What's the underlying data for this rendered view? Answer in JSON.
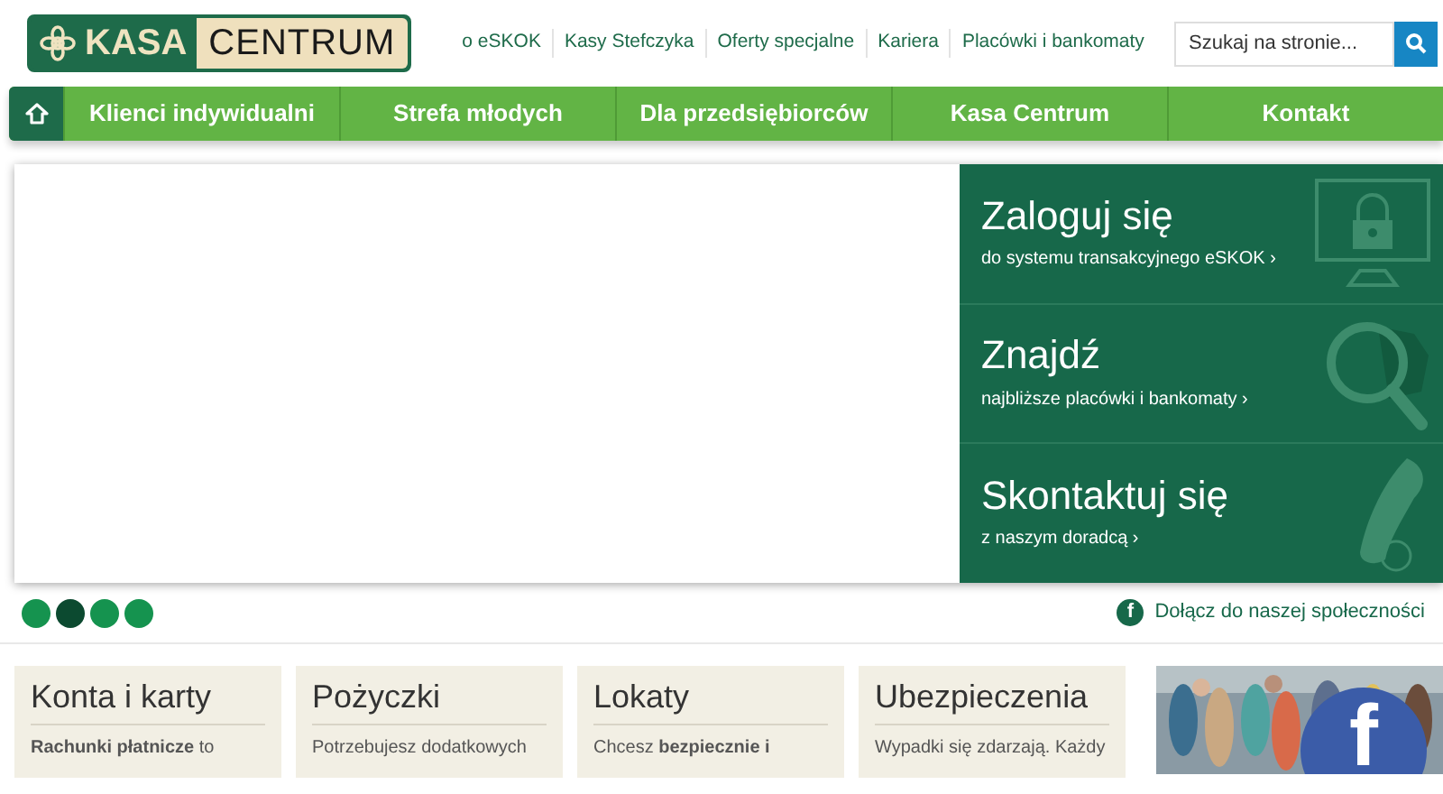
{
  "logo": {
    "left": "KASA",
    "right": "CENTRUM"
  },
  "top_links": [
    "o eSKOK",
    "Kasy Stefczyka",
    "Oferty specjalne",
    "Kariera",
    "Placówki i bankomaty"
  ],
  "search": {
    "placeholder": "Szukaj na stronie..."
  },
  "nav": [
    {
      "label": "Klienci indywidualni",
      "selected": false
    },
    {
      "label": "Strefa młodych",
      "selected": false
    },
    {
      "label": "Dla przedsiębiorców",
      "selected": false
    },
    {
      "label": "Kasa Centrum",
      "selected": false
    },
    {
      "label": "Kontakt",
      "selected": false
    }
  ],
  "home_selected": true,
  "panel": [
    {
      "kind": "login",
      "title": "Zaloguj się",
      "link": "do systemu transakcyjnego eSKOK ›"
    },
    {
      "kind": "find",
      "title": "Znajdź",
      "link": "najbliższe placówki i bankomaty ›"
    },
    {
      "kind": "contact",
      "title": "Skontaktuj się",
      "link": "z naszym doradcą ›"
    }
  ],
  "carousel_dots": [
    {
      "selected": false
    },
    {
      "selected": true
    },
    {
      "selected": false
    },
    {
      "selected": false
    }
  ],
  "social": {
    "icon": "f",
    "label": "Dołącz do naszej społeczności"
  },
  "cards": [
    {
      "title": "Konta i karty",
      "text": "**Rachunki płatnicze** to"
    },
    {
      "title": "Pożyczki",
      "text": "Potrzebujesz dodatkowych"
    },
    {
      "title": "Lokaty",
      "text": "Chcesz **bezpiecznie i**"
    },
    {
      "title": "Ubezpieczenia",
      "text": "Wypadki się zdarzają. Każdy"
    }
  ],
  "promo": {
    "kind": "picture",
    "logo": "f"
  }
}
